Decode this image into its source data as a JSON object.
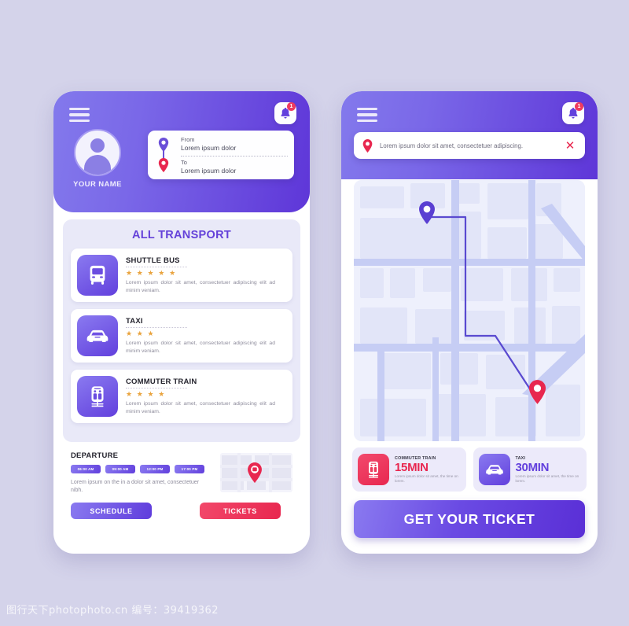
{
  "background_color": "#d4d3ea",
  "accent_purple": "#6240dd",
  "accent_red": "#e8274f",
  "star_color": "#e9a33d",
  "left_screen": {
    "header": {
      "menu_icon": "hamburger-menu-icon",
      "bell_icon": "bell-icon",
      "bell_badge": "1",
      "avatar_icon": "user-avatar-icon",
      "user_name": "YOUR NAME",
      "route": {
        "from_label": "From",
        "from_value": "Lorem ipsum dolor",
        "to_label": "To",
        "to_value": "Lorem ipsum dolor"
      }
    },
    "transport_panel": {
      "title": "ALL TRANSPORT",
      "items": [
        {
          "icon": "bus-icon",
          "name": "SHUTTLE BUS",
          "rating": 5,
          "stars": "★ ★ ★ ★ ★",
          "description": "Lorem ipsum dolor sit amet, consectetuer adipiscing elit ad minim veniam."
        },
        {
          "icon": "car-icon",
          "name": "TAXI",
          "rating": 3,
          "stars": "★ ★ ★",
          "description": "Lorem ipsum dolor sit amet, consectetuer adipiscing elit ad minim veniam."
        },
        {
          "icon": "train-icon",
          "name": "COMMUTER TRAIN",
          "rating": 4,
          "stars": "★ ★ ★ ★",
          "description": "Lorem ipsum dolor sit amet, consectetuer adipiscing elit ad minim veniam."
        }
      ]
    },
    "departure": {
      "title": "DEPARTURE",
      "times": [
        "06:00 AM",
        "09:00 AM",
        "12:00 PM",
        "17:00 PM"
      ],
      "description": "Lorem ipsum on the in a dolor sit amet, consectetuer nibh.",
      "map_thumb_icon": "map-thumbnail",
      "map_pin_icon": "location-pin-icon",
      "schedule_button": "SCHEDULE",
      "tickets_button": "TICKETS"
    }
  },
  "right_screen": {
    "header": {
      "menu_icon": "hamburger-menu-icon",
      "bell_icon": "bell-icon",
      "bell_badge": "1",
      "search": {
        "pin_icon": "location-pin-icon",
        "value": "Lorem ipsum dolor sit amet, consectetuer adipiscing.",
        "placeholder": "Lorem ipsum dolor sit amet, consectetuer adipiscing.",
        "clear_icon": "close-icon"
      }
    },
    "map": {
      "start_pin_icon": "origin-pin-icon",
      "end_pin_icon": "destination-pin-icon",
      "route_color": "#5a4ad0"
    },
    "info_cards": [
      {
        "icon": "train-icon",
        "name": "COMMUTER TRAIN",
        "time": "15MIN",
        "description": "Lorem ipsum dolor sit amet, the time on lorem.",
        "color": "#e8274f"
      },
      {
        "icon": "car-icon",
        "name": "TAXI",
        "time": "30MIN",
        "description": "Lorem ipsum dolor sit amet, the time on lorem.",
        "color": "#6240dd"
      }
    ],
    "cta_button": "GET YOUR TICKET"
  },
  "watermark": "图行天下photophoto.cn  编号：39419362"
}
